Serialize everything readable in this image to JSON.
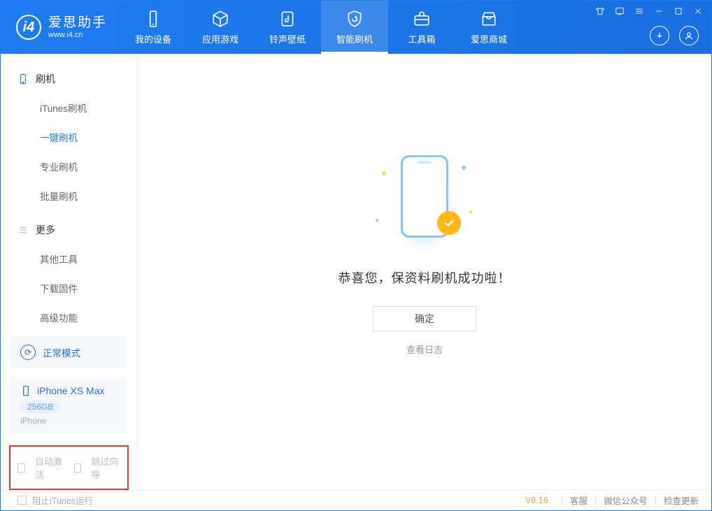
{
  "app": {
    "name": "爱思助手",
    "domain": "www.i4.cn"
  },
  "tabs": [
    {
      "label": "我的设备"
    },
    {
      "label": "应用游戏"
    },
    {
      "label": "铃声壁纸"
    },
    {
      "label": "智能刷机"
    },
    {
      "label": "工具箱"
    },
    {
      "label": "爱思商城"
    }
  ],
  "active_tab": "智能刷机",
  "sidebar": {
    "group1": "刷机",
    "items1": [
      "iTunes刷机",
      "一键刷机",
      "专业刷机",
      "批量刷机"
    ],
    "active_item": "一键刷机",
    "group2": "更多",
    "items2": [
      "其他工具",
      "下载固件",
      "高级功能"
    ]
  },
  "mode": {
    "label": "正常模式"
  },
  "device": {
    "name": "iPhone XS Max",
    "capacity": "256GB",
    "type": "iPhone"
  },
  "options": {
    "auto_activate": "自动激活",
    "skip_guide": "跳过向导"
  },
  "main": {
    "success_text": "恭喜您，保资料刷机成功啦！",
    "ok": "确定",
    "view_log": "查看日志"
  },
  "footer": {
    "block_itunes": "阻止iTunes运行",
    "version": "V8.16",
    "service": "客服",
    "wechat": "微信公众号",
    "update": "检查更新"
  }
}
